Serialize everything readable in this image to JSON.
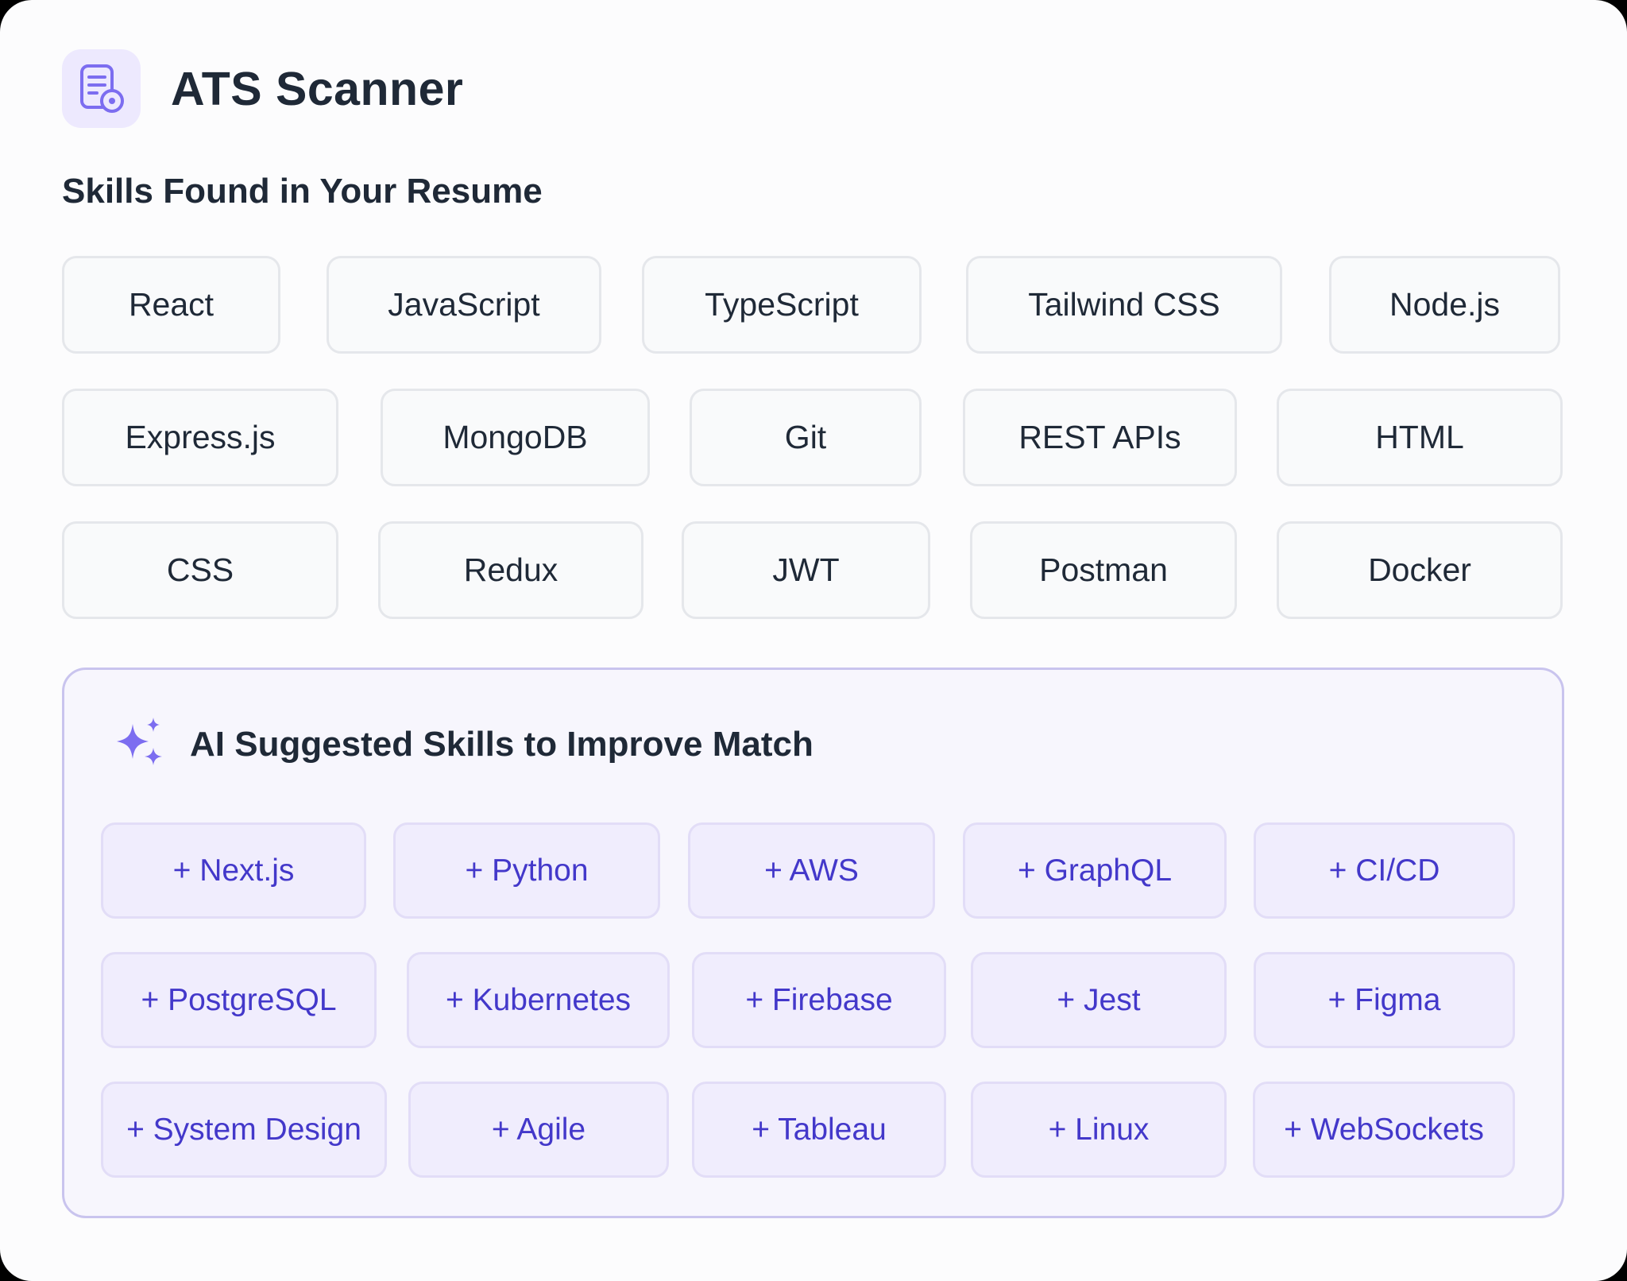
{
  "app": {
    "title": "ATS Scanner",
    "icon": "resume-scan-icon"
  },
  "skills_found": {
    "heading": "Skills Found in Your Resume",
    "items": [
      "React",
      "JavaScript",
      "TypeScript",
      "Tailwind CSS",
      "Node.js",
      "Express.js",
      "MongoDB",
      "Git",
      "REST APIs",
      "HTML",
      "CSS",
      "Redux",
      "JWT",
      "Postman",
      "Docker"
    ]
  },
  "ai_suggestions": {
    "heading": "AI Suggested Skills to Improve Match",
    "icon": "sparkles-icon",
    "items": [
      "+ Next.js",
      "+ Python",
      "+ AWS",
      "+ GraphQL",
      "+ CI/CD",
      "+ PostgreSQL",
      "+ Kubernetes",
      "+ Firebase",
      "+ Jest",
      "+ Figma",
      "+ System Design",
      "+ Agile",
      "+ Tableau",
      "+ Linux",
      "+ WebSockets"
    ]
  },
  "colors": {
    "accent": "#7c6df0",
    "suggestion_text": "#4338ca",
    "panel_border": "#c9c4ee"
  }
}
